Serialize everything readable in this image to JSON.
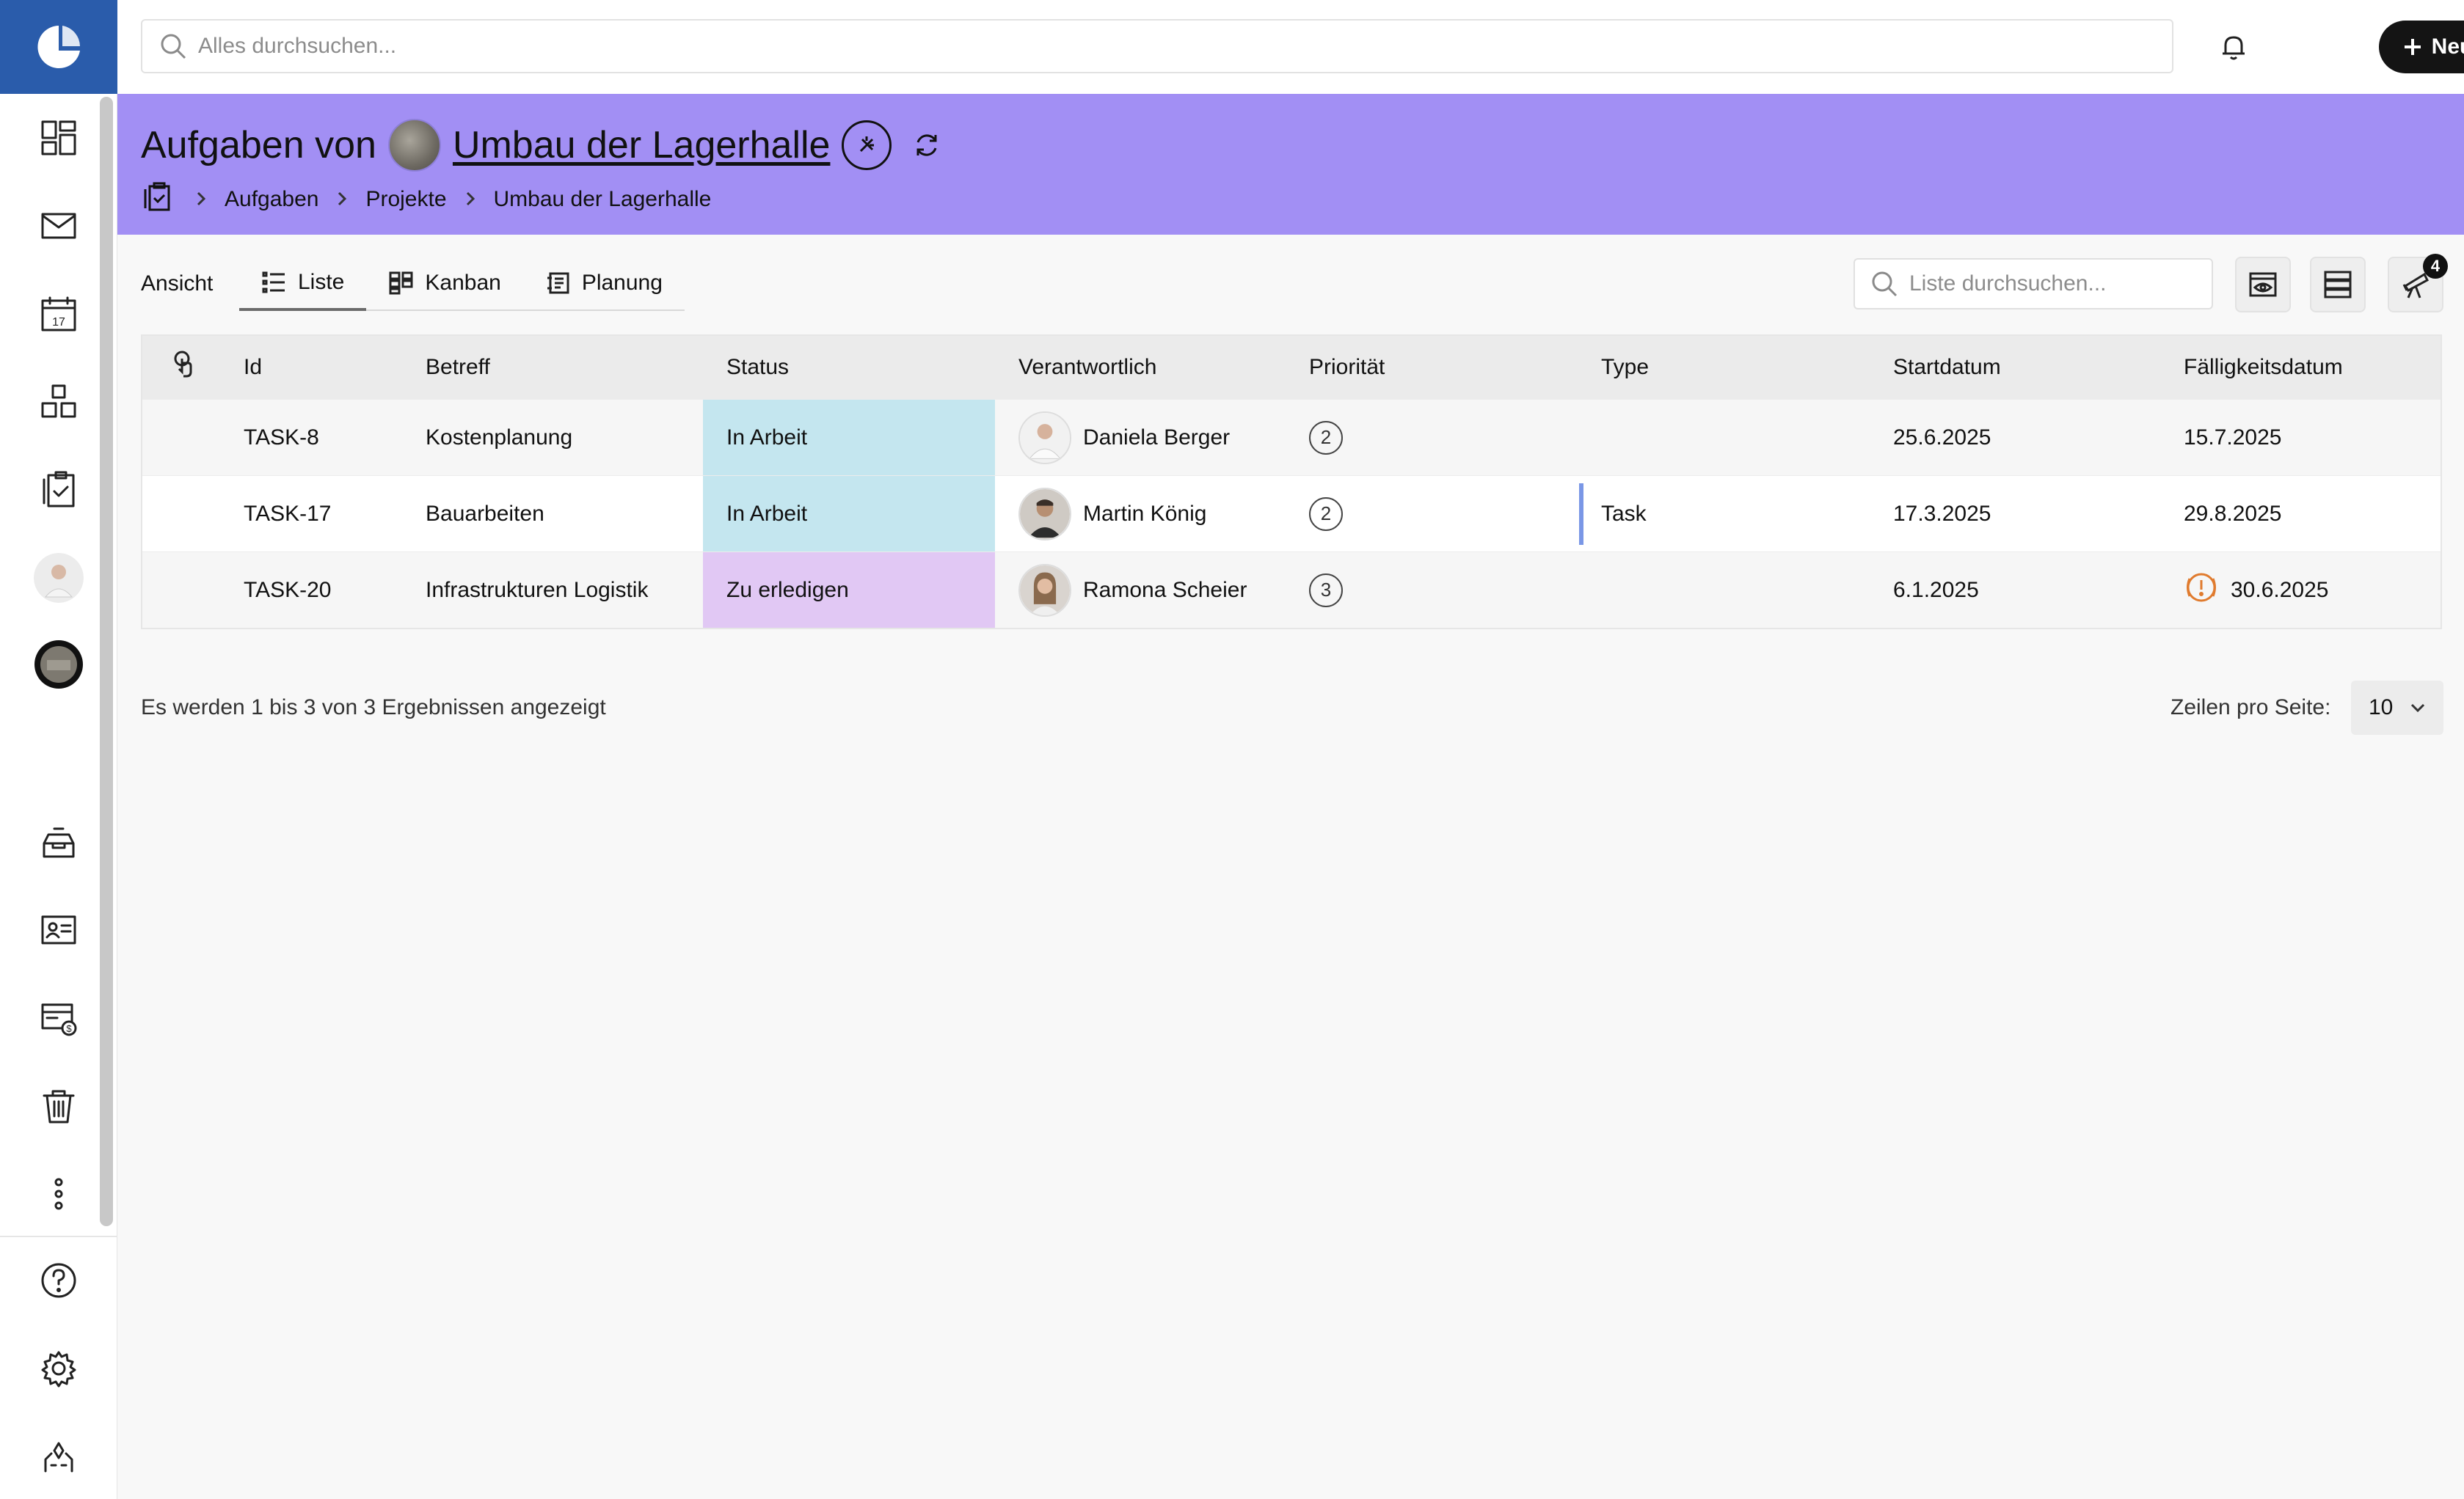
{
  "topbar": {
    "search_placeholder": "Alles durchsuchen...",
    "new_button": "Neu"
  },
  "header": {
    "title_prefix": "Aufgaben von",
    "project_name": "Umbau der Lagerhalle",
    "breadcrumb": [
      "Aufgaben",
      "Projekte",
      "Umbau der Lagerhalle"
    ]
  },
  "toolbar": {
    "view_label": "Ansicht",
    "tabs": [
      {
        "label": "Liste",
        "icon": "list-icon",
        "active": true
      },
      {
        "label": "Kanban",
        "icon": "kanban-icon",
        "active": false
      },
      {
        "label": "Planung",
        "icon": "planning-icon",
        "active": false
      }
    ],
    "list_search_placeholder": "Liste durchsuchen...",
    "filter_badge": "4"
  },
  "table": {
    "columns": [
      "Id",
      "Betreff",
      "Status",
      "Verantwortlich",
      "Priorität",
      "Type",
      "Startdatum",
      "Fälligkeitsdatum"
    ],
    "rows": [
      {
        "id": "TASK-8",
        "subject": "Kostenplanung",
        "status": "In Arbeit",
        "status_color": "#c4e6ef",
        "assignee": "Daniela Berger",
        "priority": "2",
        "type": "",
        "start": "25.6.2025",
        "due": "15.7.2025",
        "overdue": false
      },
      {
        "id": "TASK-17",
        "subject": "Bauarbeiten",
        "status": "In Arbeit",
        "status_color": "#c4e6ef",
        "assignee": "Martin König",
        "priority": "2",
        "type": "Task",
        "start": "17.3.2025",
        "due": "29.8.2025",
        "overdue": false
      },
      {
        "id": "TASK-20",
        "subject": "Infrastrukturen Logistik",
        "status": "Zu erledigen",
        "status_color": "#e1c8f4",
        "assignee": "Ramona Scheier",
        "priority": "3",
        "type": "",
        "start": "6.1.2025",
        "due": "30.6.2025",
        "overdue": true
      }
    ]
  },
  "footer": {
    "result_info": "Es werden 1 bis 3 von 3 Ergebnissen angezeigt",
    "rows_per_page_label": "Zeilen pro Seite:",
    "rows_per_page_value": "10"
  },
  "colors": {
    "brand_blue": "#2a5cab",
    "header_purple": "#a28ff4",
    "status_in_progress": "#c4e6ef",
    "status_todo": "#e1c8f4",
    "overdue_orange": "#e07b2e"
  }
}
